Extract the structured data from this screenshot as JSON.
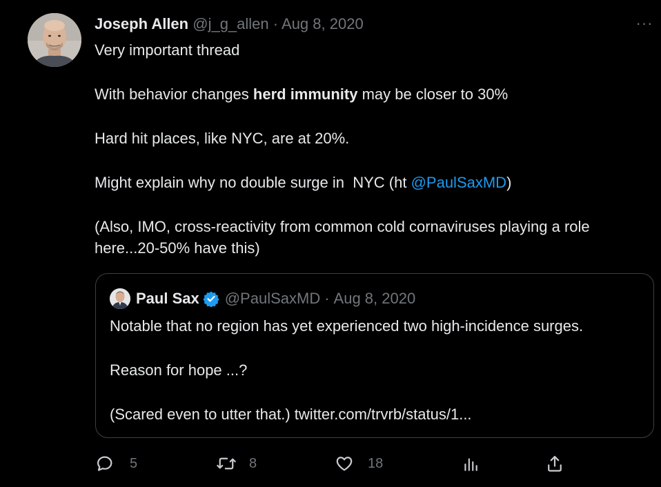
{
  "tweet": {
    "author_name": "Joseph Allen",
    "handle": "@j_g_allen",
    "separator": "·",
    "date": "Aug 8, 2020",
    "more_label": "···",
    "line1": "Very important thread",
    "line2_pre": "With behavior changes ",
    "line2_bold": "herd immunity",
    "line2_post": " may be closer to 30%",
    "line3": "Hard hit places, like NYC, are at 20%.",
    "line4_pre": "Might explain why no double surge in  NYC (ht ",
    "line4_mention": "@PaulSaxMD",
    "line4_post": ")",
    "line5": "(Also, IMO, cross-reactivity from common cold cornaviruses playing a role here...20-50% have this)"
  },
  "quote": {
    "author_name": "Paul Sax",
    "handle": "@PaulSaxMD",
    "separator": "·",
    "date": "Aug 8, 2020",
    "line1": "Notable that no region has yet experienced two high-incidence surges.",
    "line2": "Reason for hope ...?",
    "line3": "(Scared even to utter that.) twitter.com/trvrb/status/1..."
  },
  "actions": {
    "reply_count": "5",
    "retweet_count": "8",
    "like_count": "18"
  },
  "colors": {
    "background": "#000000",
    "text": "#e7e9ea",
    "muted": "#71767b",
    "link": "#1d9bf0",
    "border": "#3e4144"
  }
}
